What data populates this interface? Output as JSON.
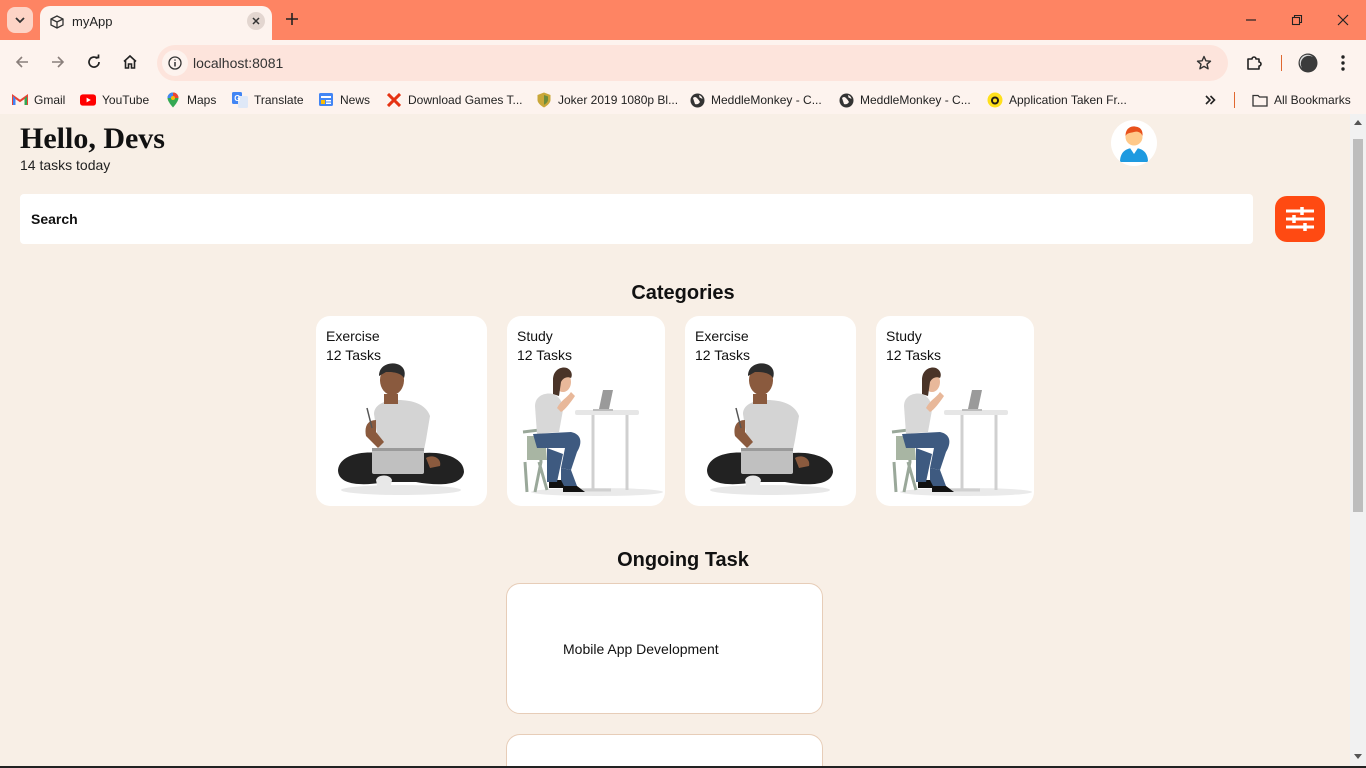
{
  "browser": {
    "tab_title": "myApp",
    "url": "localhost:8081",
    "bookmarks": [
      {
        "label": "Gmail",
        "icon": "gmail-icon"
      },
      {
        "label": "YouTube",
        "icon": "youtube-icon"
      },
      {
        "label": "Maps",
        "icon": "maps-icon"
      },
      {
        "label": "Translate",
        "icon": "translate-icon"
      },
      {
        "label": "News",
        "icon": "news-icon"
      },
      {
        "label": "Download Games T...",
        "icon": "x-icon"
      },
      {
        "label": "Joker 2019 1080p Bl...",
        "icon": "shield-icon"
      },
      {
        "label": "MeddleMonkey - C...",
        "icon": "globe-icon"
      },
      {
        "label": "MeddleMonkey - C...",
        "icon": "globe-icon"
      },
      {
        "label": "Application Taken Fr...",
        "icon": "mailchimp-icon"
      }
    ],
    "all_bookmarks": "All Bookmarks"
  },
  "header": {
    "greeting": "Hello, Devs",
    "subtitle": "14 tasks today"
  },
  "search": {
    "placeholder": "Search"
  },
  "categories": {
    "title": "Categories",
    "items": [
      {
        "name": "Exercise",
        "count": "12 Tasks",
        "illustration": "person-sitting-laptop"
      },
      {
        "name": "Study",
        "count": "12 Tasks",
        "illustration": "person-at-desk"
      },
      {
        "name": "Exercise",
        "count": "12 Tasks",
        "illustration": "person-sitting-laptop"
      },
      {
        "name": "Study",
        "count": "12 Tasks",
        "illustration": "person-at-desk"
      }
    ]
  },
  "ongoing": {
    "title": "Ongoing Task",
    "items": [
      {
        "label": "Mobile App Development"
      },
      {
        "label": ""
      }
    ]
  },
  "colors": {
    "tabstrip": "#fe8463",
    "accent": "#ff4a12",
    "page_bg": "#f8efe6"
  }
}
